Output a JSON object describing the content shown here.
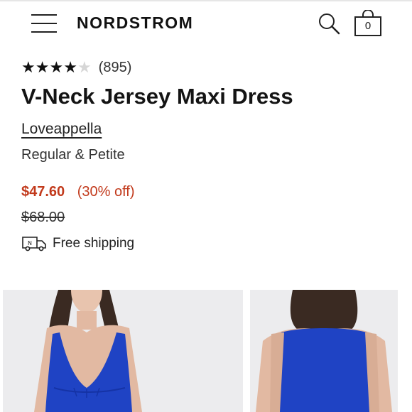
{
  "header": {
    "menu_icon": "hamburger-menu-icon",
    "brand": "NORDSTROM",
    "search_icon": "search-icon",
    "bag_icon": "shopping-bag-icon",
    "bag_count": "0"
  },
  "product": {
    "rating": 4,
    "rating_max": 5,
    "review_count": "(895)",
    "title": "V-Neck Jersey Maxi Dress",
    "brand": "Loveappella",
    "size_range": "Regular & Petite",
    "sale_price": "$47.60",
    "discount": "(30% off)",
    "original_price": "$68.00",
    "shipping_icon": "delivery-truck-icon",
    "shipping": "Free shipping"
  },
  "gallery": {
    "images": [
      {
        "view": "front",
        "dress_color": "#1f43c4"
      },
      {
        "view": "back",
        "dress_color": "#1f43c4"
      }
    ]
  },
  "colors": {
    "sale": "#c23a1c",
    "text": "#1a1a1a",
    "dress": "#1f43c4"
  }
}
